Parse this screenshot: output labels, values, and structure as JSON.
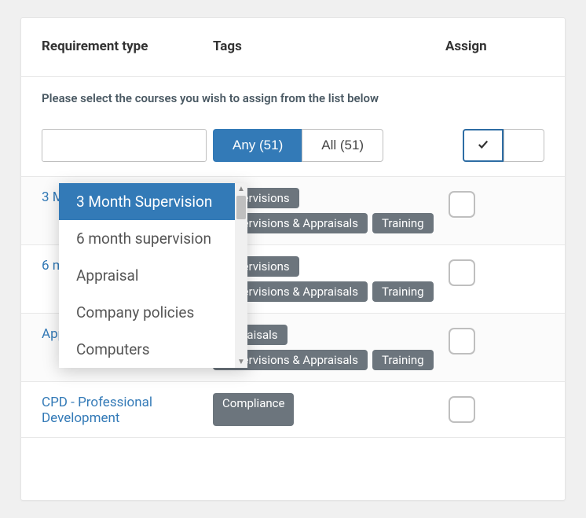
{
  "headers": {
    "requirement_type": "Requirement type",
    "tags": "Tags",
    "assign": "Assign"
  },
  "instruction": "Please select the courses you wish to assign from the list below",
  "filters": {
    "search_value": "",
    "any_label": "Any (51)",
    "all_label": "All (51)",
    "active": "any"
  },
  "dropdown": {
    "highlighted": 0,
    "items": [
      "3 Month Supervision",
      "6 month supervision",
      "Appraisal",
      "Company policies",
      "Computers"
    ]
  },
  "courses": [
    {
      "name": "3 Month Supervision",
      "tags": [
        "Supervisions",
        "Supervisions & Appraisals",
        "Training"
      ],
      "assigned": false
    },
    {
      "name": "6 month supervision",
      "tags": [
        "Supervisions",
        "Supervisions & Appraisals",
        "Training"
      ],
      "assigned": false
    },
    {
      "name": "Appraisal",
      "tags": [
        "Appraisals",
        "Supervisions & Appraisals",
        "Training"
      ],
      "assigned": false
    },
    {
      "name": "CPD - Professional Development",
      "tags": [
        "Compliance"
      ],
      "assigned": false
    }
  ]
}
